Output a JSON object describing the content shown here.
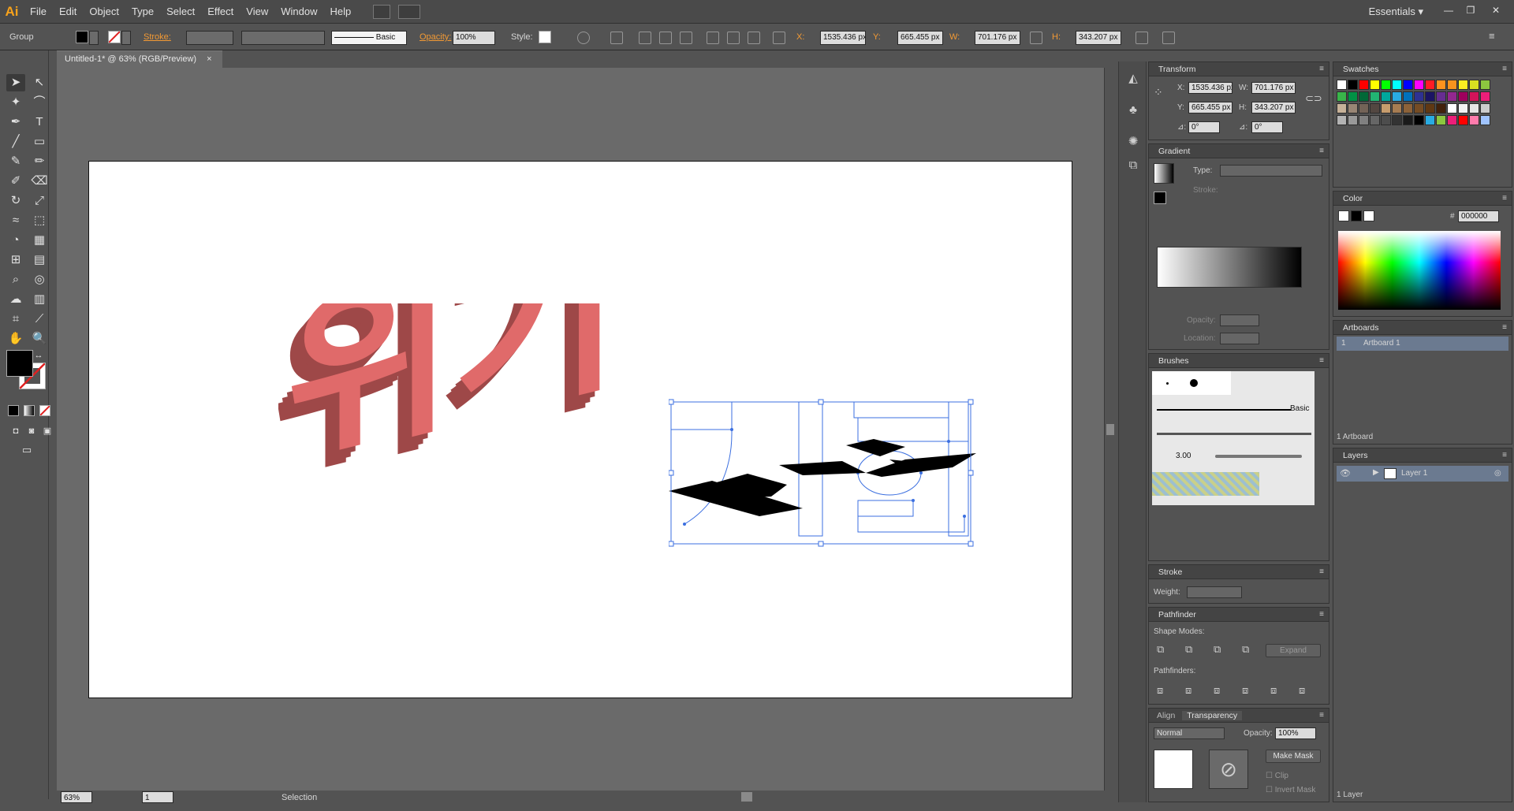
{
  "app": {
    "logo": "Ai",
    "menu": [
      "File",
      "Edit",
      "Object",
      "Type",
      "Select",
      "Effect",
      "View",
      "Window",
      "Help"
    ],
    "workspace": "Essentials",
    "window_buttons": [
      "—",
      "❐",
      "✕"
    ]
  },
  "control_bar": {
    "selection_type": "Group",
    "stroke_label": "Stroke:",
    "brush_style": "Basic",
    "opacity_label": "Opacity:",
    "opacity_value": "100%",
    "style_label": "Style:",
    "x_label": "X:",
    "x_value": "1535.436 px",
    "y_label": "Y:",
    "y_value": "665.455 px",
    "w_label": "W:",
    "w_value": "701.176 px",
    "h_label": "H:",
    "h_value": "343.207 px"
  },
  "document": {
    "tab_title": "Untitled-1* @ 63% (RGB/Preview)",
    "close_icon": "×"
  },
  "artwork": {
    "left_text": "위기",
    "left_text_color": "#e06a6a",
    "left_text_side_color": "#9e4848",
    "right_text": "기회",
    "selection_color": "#3b6fe0"
  },
  "status": {
    "zoom": "63%",
    "page": "1",
    "tool": "Selection"
  },
  "transform": {
    "title": "Transform",
    "x_label": "X:",
    "x": "1535.436 px",
    "y_label": "Y:",
    "y": "665.455 px",
    "w_label": "W:",
    "w": "701.176 px",
    "h_label": "H:",
    "h": "343.207 px",
    "rotate_label": "⊿:",
    "rotate": "0°",
    "shear_label": "⊿:",
    "shear": "0°"
  },
  "gradient": {
    "title": "Gradient",
    "type_label": "Type:",
    "stroke_label": "Stroke:",
    "opacity_label": "Opacity:",
    "location_label": "Location:"
  },
  "brushes": {
    "title": "Brushes",
    "basic_label": "Basic",
    "size_label": "3.00"
  },
  "stroke": {
    "title": "Stroke",
    "weight_label": "Weight:"
  },
  "pathfinder": {
    "title": "Pathfinder",
    "shape_modes_label": "Shape Modes:",
    "expand_label": "Expand",
    "pathfinders_label": "Pathfinders:"
  },
  "transparency": {
    "tab_align": "Align",
    "tab_transparency": "Transparency",
    "blend_mode": "Normal",
    "opacity_label": "Opacity:",
    "opacity": "100%",
    "make_mask": "Make Mask",
    "clip_label": "Clip",
    "invert_label": "Invert Mask"
  },
  "swatches": {
    "title": "Swatches",
    "colors": [
      "#ffffff",
      "#000000",
      "#ff0000",
      "#ffff00",
      "#00ff00",
      "#00ffff",
      "#0000ff",
      "#ff00ff",
      "#ff1d25",
      "#ff931e",
      "#f7931e",
      "#fcee21",
      "#d9e021",
      "#8cc63f",
      "#39b54a",
      "#009245",
      "#006837",
      "#22b573",
      "#00a99d",
      "#29abe2",
      "#0071bc",
      "#2e3192",
      "#1b1464",
      "#662d91",
      "#93278f",
      "#9e005d",
      "#d4145a",
      "#ed1e79",
      "#c7b299",
      "#998675",
      "#736357",
      "#534741",
      "#c69c6d",
      "#a67c52",
      "#8c6239",
      "#754c24",
      "#603813",
      "#42210b",
      "#ffffff",
      "#f2f2f2",
      "#e6e6e6",
      "#cccccc",
      "#b3b3b3",
      "#999999",
      "#808080",
      "#666666",
      "#4d4d4d",
      "#333333",
      "#1a1a1a",
      "#000000",
      "#29abe2",
      "#8cc63f",
      "#ed1e79",
      "#ff0000",
      "#ff7bac",
      "#a0c4ff"
    ]
  },
  "color": {
    "title": "Color",
    "hex_label": "#",
    "hex": "000000"
  },
  "artboards": {
    "title": "Artboards",
    "row_index": "1",
    "row_name": "Artboard 1",
    "footer": "1 Artboard"
  },
  "layers": {
    "title": "Layers",
    "layer_name": "Layer 1",
    "footer": "1 Layer"
  }
}
